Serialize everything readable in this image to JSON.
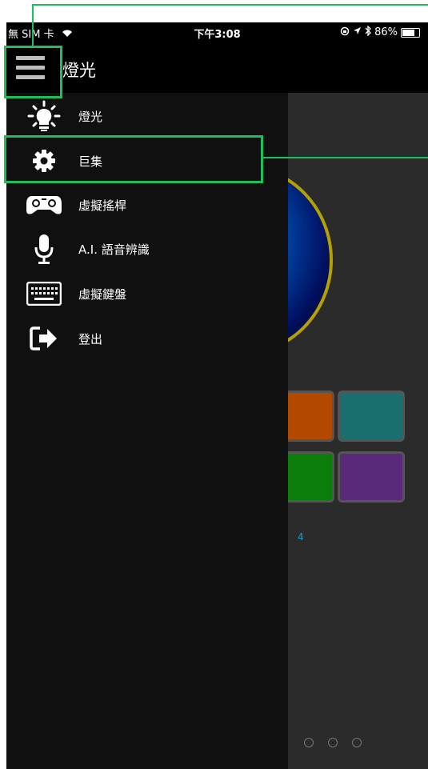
{
  "status_bar": {
    "carrier": "無 SIM 卡",
    "time": "下午3:08",
    "battery": "86%",
    "battery_level": 0.86
  },
  "header": {
    "title": "燈光"
  },
  "menu": {
    "items": [
      {
        "label": "燈光",
        "icon": "lightbulb-icon"
      },
      {
        "label": "巨集",
        "icon": "gear-icon"
      },
      {
        "label": "虛擬搖桿",
        "icon": "gamepad-icon"
      },
      {
        "label": "A.I. 語音辨識",
        "icon": "microphone-icon"
      },
      {
        "label": "虛擬鍵盤",
        "icon": "keyboard-icon"
      },
      {
        "label": "登出",
        "icon": "logout-icon"
      }
    ]
  },
  "background": {
    "page_number": "4",
    "swatch_colors": [
      "#b34a00",
      "#1a6e6e",
      "#0b7d0b",
      "#5a2a7a"
    ]
  },
  "highlight_color": "#1dbf5c"
}
